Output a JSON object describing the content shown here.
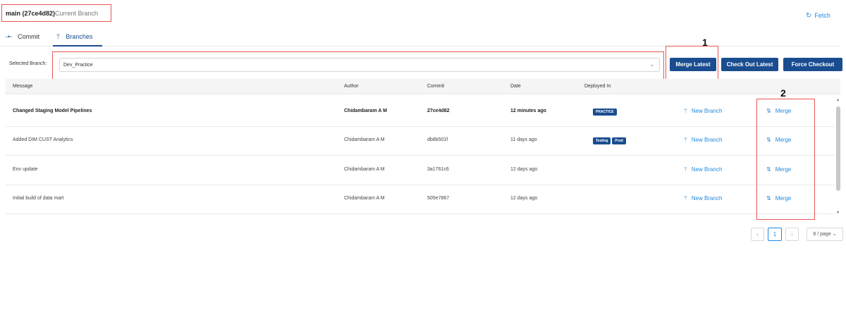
{
  "header": {
    "branch_name": "main (27ce4d82)",
    "branch_sub": "Current Branch",
    "fetch_label": "Fetch"
  },
  "tabs": [
    {
      "label": "Commit",
      "icon": "commit-icon"
    },
    {
      "label": "Branches",
      "icon": "branch-icon",
      "active": true
    }
  ],
  "selector": {
    "label": "Selected Branch:",
    "value": "Dev_Practice"
  },
  "buttons": {
    "merge_latest": "Merge Latest",
    "check_out_latest": "Check Out Latest",
    "force_checkout": "Force Checkout"
  },
  "annotations": {
    "one": "1",
    "two": "2"
  },
  "table": {
    "columns": [
      "Message",
      "Author",
      "Commit",
      "Date",
      "Deployed In"
    ],
    "rows": [
      {
        "message": "Changed Staging Model Pipelines",
        "author": "Chidambaram A M",
        "commit": "27ce4d82",
        "date": "12 minutes ago",
        "deployed": [
          "PRACTICE"
        ],
        "new_branch": "New Branch",
        "merge": "Merge"
      },
      {
        "message": "Added DIM CUST Analytics",
        "author": "Chidambaram A M",
        "commit": "db8b501f",
        "date": "11 days ago",
        "deployed": [
          "Testing",
          "Prod"
        ],
        "new_branch": "New Branch",
        "merge": "Merge"
      },
      {
        "message": "Env update",
        "author": "Chidambaram A M",
        "commit": "3a1761c6",
        "date": "12 days ago",
        "deployed": [],
        "new_branch": "New Branch",
        "merge": "Merge"
      },
      {
        "message": "Initial build of data mart",
        "author": "Chidambaram A M",
        "commit": "505e7867",
        "date": "12 days ago",
        "deployed": [],
        "new_branch": "New Branch",
        "merge": "Merge"
      }
    ]
  },
  "pagination": {
    "current_page": "1",
    "page_size": "8 / page"
  },
  "colors": {
    "primary": "#1a4d8f",
    "link": "#1f8ae0",
    "annotation_red": "#e85555"
  }
}
